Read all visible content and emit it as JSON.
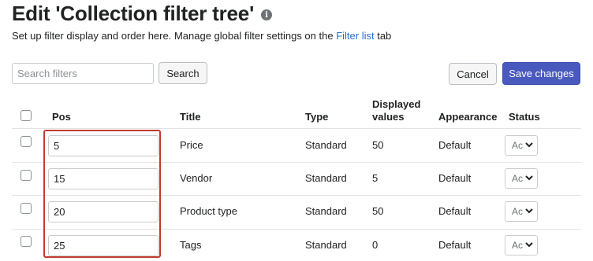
{
  "page": {
    "title": "Edit 'Collection filter tree'",
    "info_icon": "info-icon",
    "subtitle_prefix": "Set up filter display and order here. Manage global filter settings on the ",
    "subtitle_link": "Filter list",
    "subtitle_suffix": " tab"
  },
  "toolbar": {
    "search_placeholder": "Search filters",
    "search_label": "Search",
    "cancel_label": "Cancel",
    "save_label": "Save changes"
  },
  "colors": {
    "primary": "#4959bd",
    "link": "#2c6ecb",
    "highlight": "#c23b2e"
  },
  "table": {
    "columns": {
      "pos": "Pos",
      "title": "Title",
      "type": "Type",
      "displayed_values_line1": "Displayed",
      "displayed_values_line2": "values",
      "appearance": "Appearance",
      "status": "Status"
    },
    "rows": [
      {
        "pos": "5",
        "title": "Price",
        "type": "Standard",
        "displayed_values": "50",
        "appearance": "Default",
        "status": "Active"
      },
      {
        "pos": "15",
        "title": "Vendor",
        "type": "Standard",
        "displayed_values": "5",
        "appearance": "Default",
        "status": "Active"
      },
      {
        "pos": "20",
        "title": "Product type",
        "type": "Standard",
        "displayed_values": "50",
        "appearance": "Default",
        "status": "Active"
      },
      {
        "pos": "25",
        "title": "Tags",
        "type": "Standard",
        "displayed_values": "0",
        "appearance": "Default",
        "status": "Active"
      }
    ]
  }
}
